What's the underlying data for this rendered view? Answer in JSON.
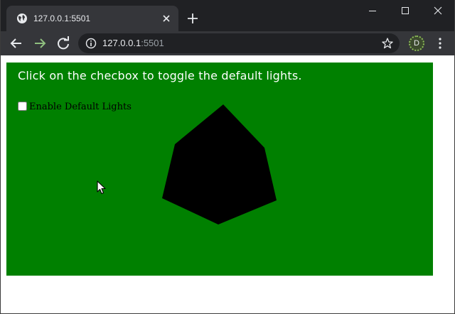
{
  "browser": {
    "tab_title": "127.0.0.1:5501",
    "url_host": "127.0.0.1",
    "url_port": ":5501",
    "profile_initial": "D"
  },
  "page": {
    "instruction": "Click on the checbox to toggle the default lights.",
    "checkbox_label": "Enable Default Lights",
    "checkbox_checked": false,
    "scene_background": "#008000",
    "cube_color": "#000000"
  },
  "icons": {
    "favicon": "globe-icon",
    "close_tab": "close-icon",
    "new_tab": "plus-icon",
    "back": "arrow-left-icon",
    "forward": "arrow-right-icon",
    "reload": "reload-icon",
    "site_info": "info-icon",
    "bookmark": "star-icon",
    "menu": "kebab-menu-icon"
  }
}
